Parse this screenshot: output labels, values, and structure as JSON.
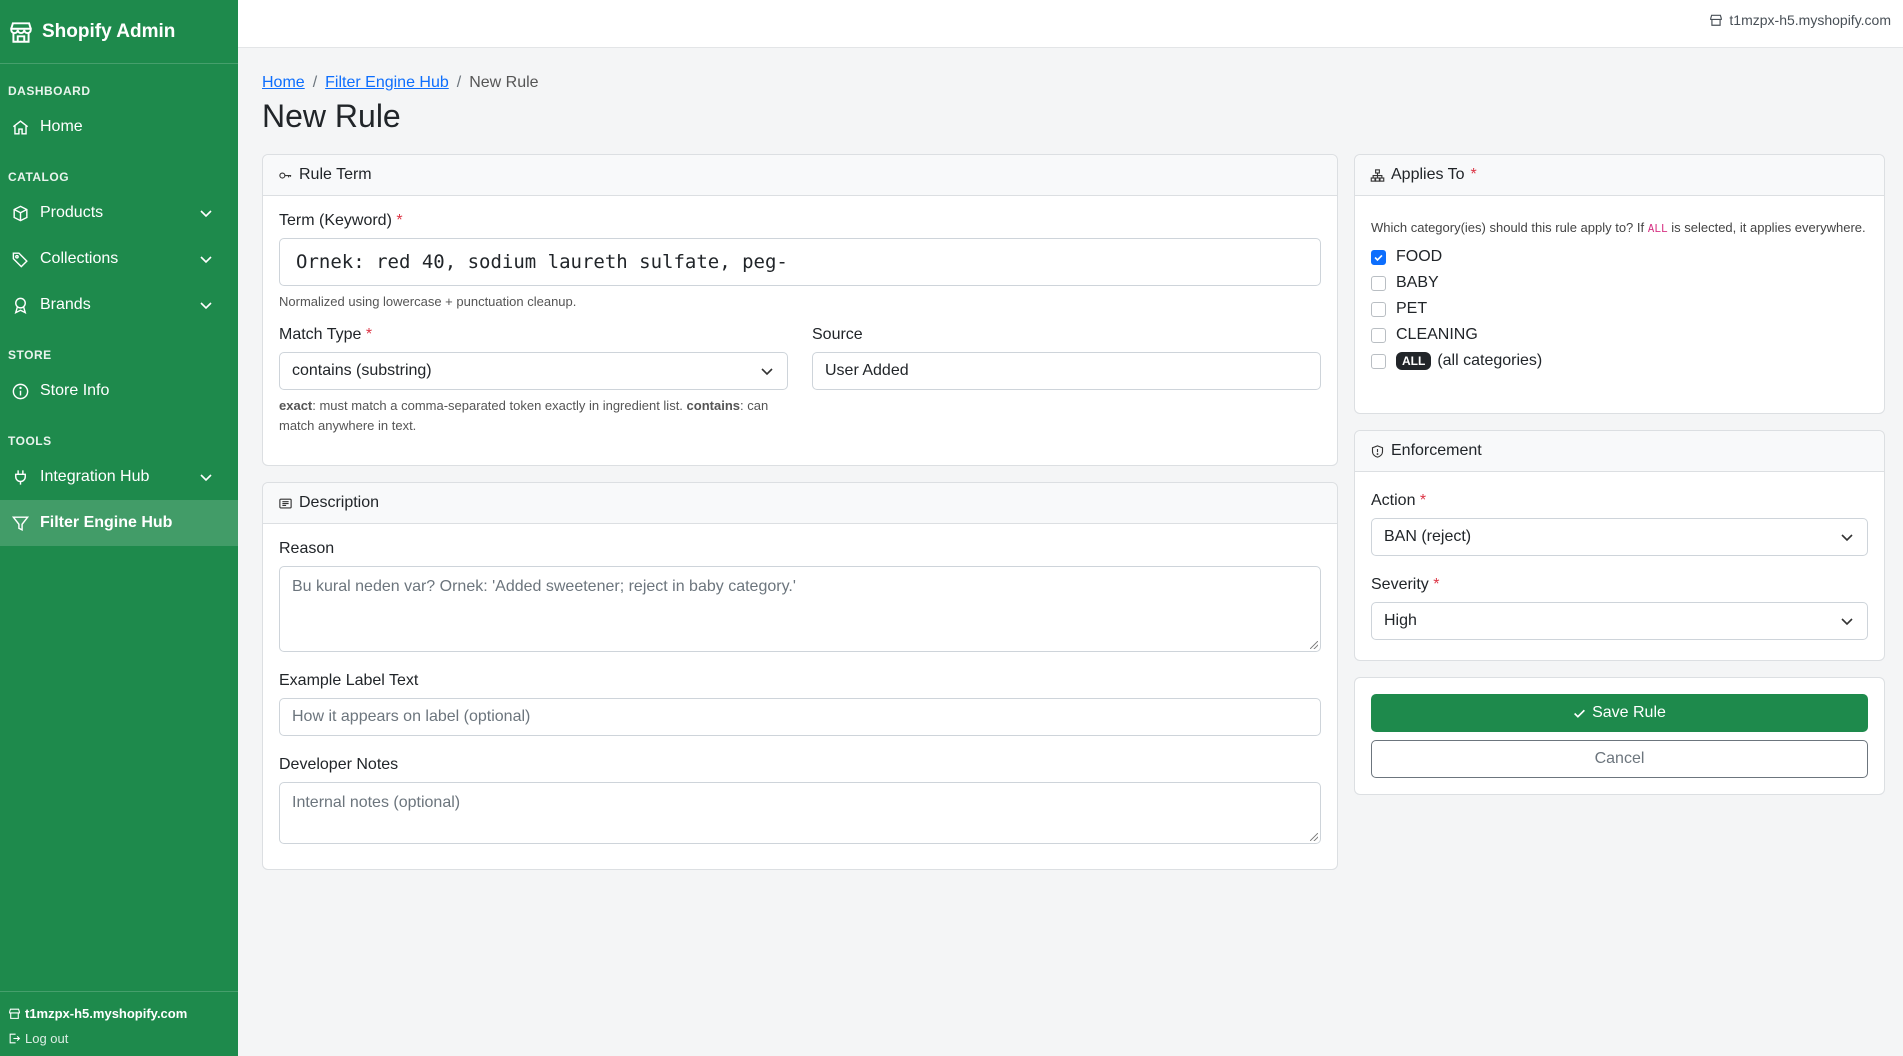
{
  "app": {
    "title": "Shopify Admin"
  },
  "sidebar": {
    "sections": [
      {
        "label": "DASHBOARD"
      },
      {
        "label": "CATALOG"
      },
      {
        "label": "STORE"
      },
      {
        "label": "TOOLS"
      }
    ],
    "items": {
      "home": "Home",
      "products": "Products",
      "collections": "Collections",
      "brands": "Brands",
      "store_info": "Store Info",
      "integration_hub": "Integration Hub",
      "filter_engine_hub": "Filter Engine Hub"
    },
    "footer": {
      "store": "t1mzpx-h5.myshopify.com",
      "logout": "Log out"
    }
  },
  "topbar": {
    "store": "t1mzpx-h5.myshopify.com"
  },
  "breadcrumb": {
    "home": "Home",
    "hub": "Filter Engine Hub",
    "current": "New Rule",
    "sep": "/"
  },
  "page": {
    "title": "New Rule"
  },
  "rule_term": {
    "header": "Rule Term",
    "term_label": "Term (Keyword)",
    "term_value": "Ornek: red 40, sodium laureth sulfate, peg-",
    "term_help": "Normalized using lowercase + punctuation cleanup.",
    "match_type_label": "Match Type",
    "match_type_value": "contains (substring)",
    "source_label": "Source",
    "source_value": "User Added",
    "help_exact": "exact",
    "help_exact_text": ": must match a comma-separated token exactly in ingredient list. ",
    "help_contains": "contains",
    "help_contains_text": ": can match anywhere in text."
  },
  "description": {
    "header": "Description",
    "reason_label": "Reason",
    "reason_placeholder": "Bu kural neden var? Ornek: 'Added sweetener; reject in baby category.'",
    "example_label": "Example Label Text",
    "example_placeholder": "How it appears on label (optional)",
    "notes_label": "Developer Notes",
    "notes_placeholder": "Internal notes (optional)"
  },
  "applies_to": {
    "header": "Applies To",
    "help_before": "Which category(ies) should this rule apply to? If ",
    "help_code": "ALL",
    "help_after": " is selected, it applies everywhere.",
    "options": [
      {
        "label": "FOOD",
        "checked": true
      },
      {
        "label": "BABY",
        "checked": false
      },
      {
        "label": "PET",
        "checked": false
      },
      {
        "label": "CLEANING",
        "checked": false
      }
    ],
    "all_badge": "ALL",
    "all_label": "(all categories)"
  },
  "enforcement": {
    "header": "Enforcement",
    "action_label": "Action",
    "action_value": "BAN (reject)",
    "severity_label": "Severity",
    "severity_value": "High"
  },
  "actions": {
    "save": "Save Rule",
    "cancel": "Cancel"
  },
  "required_mark": "*",
  "colors": {
    "brand_green": "#1e8a4c",
    "link": "#0d6efd",
    "required": "#dc3545",
    "checkbox": "#0d6efd"
  }
}
